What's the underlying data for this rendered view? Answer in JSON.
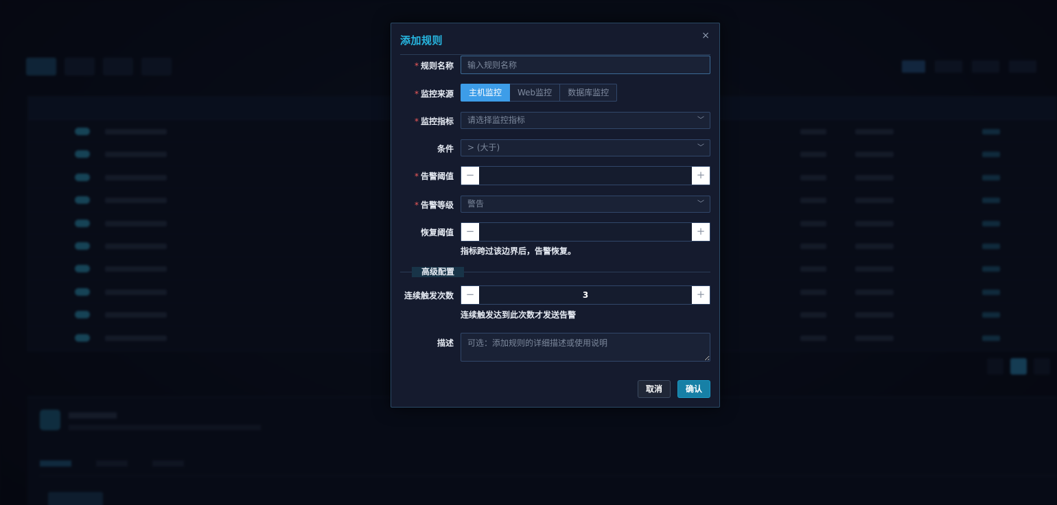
{
  "dialog": {
    "title": "添加规则",
    "close": "×",
    "fields": {
      "rule_name": {
        "label": "规则名称",
        "placeholder": "输入规则名称",
        "required": "*"
      },
      "source": {
        "label": "监控来源",
        "required": "*",
        "options": [
          "主机监控",
          "Web监控",
          "数据库监控"
        ],
        "selected": "主机监控"
      },
      "metric": {
        "label": "监控指标",
        "placeholder": "请选择监控指标",
        "required": "*"
      },
      "condition": {
        "label": "条件",
        "value": "> (大于)"
      },
      "threshold": {
        "label": "告警阈值",
        "required": "*",
        "value": ""
      },
      "level": {
        "label": "告警等级",
        "value": "警告",
        "required": "*"
      },
      "recovery": {
        "label": "恢复阈值",
        "value": "",
        "hint": "指标跨过该边界后，告警恢复。"
      },
      "advanced": {
        "section": "高级配置"
      },
      "trigger_count": {
        "label": "连续触发次数",
        "value": "3",
        "hint": "连续触发达到此次数才发送告警"
      },
      "description": {
        "label": "描述",
        "placeholder": "可选：添加规则的详细描述或使用说明"
      }
    },
    "stepper": {
      "minus": "−",
      "plus": "+"
    },
    "chevron": "﹀",
    "buttons": {
      "cancel": "取消",
      "confirm": "确认"
    }
  },
  "colors": {
    "accent": "#27b6e0",
    "primary": "#3d9de8",
    "confirm": "#1780a6",
    "required": "#f05a5a"
  },
  "icons": {
    "close": "close-icon",
    "dropdown": "chevron-down-icon",
    "minus": "minus-icon",
    "plus": "plus-icon"
  }
}
